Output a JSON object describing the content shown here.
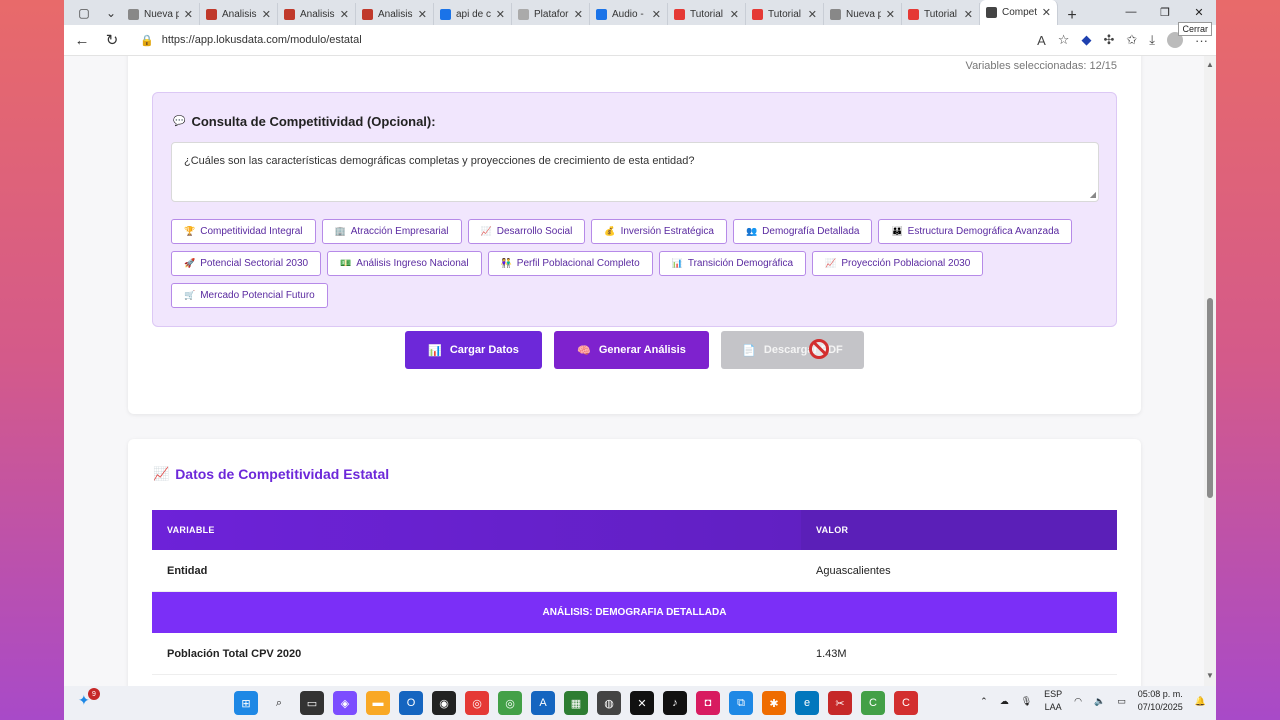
{
  "browser": {
    "tabs": [
      {
        "title": "Nueva p",
        "color": "#888888"
      },
      {
        "title": "Analisis",
        "color": "#c0392b"
      },
      {
        "title": "Analisis",
        "color": "#c0392b"
      },
      {
        "title": "Analisis",
        "color": "#c0392b"
      },
      {
        "title": "api de c",
        "color": "#1a73e8"
      },
      {
        "title": "Platafor",
        "color": "#aaaaaa"
      },
      {
        "title": "Audio -",
        "color": "#1a73e8"
      },
      {
        "title": "Tutorial",
        "color": "#e53935"
      },
      {
        "title": "Tutorial",
        "color": "#e53935"
      },
      {
        "title": "Nueva p",
        "color": "#888888"
      },
      {
        "title": "Tutorial",
        "color": "#e53935"
      },
      {
        "title": "Compet",
        "color": "#444444"
      }
    ],
    "url": "https://app.lokusdata.com/modulo/estatal",
    "tooltip": "Cerrar"
  },
  "form": {
    "variables_seleccionadas": "Variables seleccionadas: 12/15",
    "consulta_title": "Consulta de Competitividad (Opcional):",
    "consulta_text": "¿Cuáles son las características demográficas completas y proyecciones de crecimiento de esta entidad?",
    "chips_row1": [
      {
        "icon": "🏆",
        "label": "Competitividad Integral"
      },
      {
        "icon": "🏢",
        "label": "Atracción Empresarial"
      },
      {
        "icon": "📈",
        "label": "Desarrollo Social"
      },
      {
        "icon": "💰",
        "label": "Inversión Estratégica"
      },
      {
        "icon": "👥",
        "label": "Demografía Detallada"
      },
      {
        "icon": "👪",
        "label": "Estructura Demográfica Avanzada"
      }
    ],
    "chips_row2": [
      {
        "icon": "🚀",
        "label": "Potencial Sectorial 2030"
      },
      {
        "icon": "💵",
        "label": "Análisis Ingreso Nacional"
      },
      {
        "icon": "👫",
        "label": "Perfil Poblacional Completo"
      },
      {
        "icon": "📊",
        "label": "Transición Demográfica"
      },
      {
        "icon": "📈",
        "label": "Proyección Poblacional 2030"
      }
    ],
    "chips_row3": [
      {
        "icon": "🛒",
        "label": "Mercado Potencial Futuro"
      }
    ],
    "btn_cargar": "Cargar Datos",
    "btn_generar": "Generar Análisis",
    "btn_descargar": "Descargar PDF"
  },
  "datos": {
    "title": "Datos de Competitividad Estatal",
    "col_variable": "VARIABLE",
    "col_valor": "VALOR",
    "row_entidad_label": "Entidad",
    "row_entidad_value": "Aguascalientes",
    "section_label": "ANÁLISIS: DEMOGRAFIA DETALLADA",
    "row_poblacion_label": "Población Total CPV 2020",
    "row_poblacion_value": "1.43M"
  },
  "taskbar": {
    "badge_count": "9",
    "lang_top": "ESP",
    "lang_bottom": "LAA",
    "time": "05:08 p. m.",
    "date": "07/10/2025"
  }
}
